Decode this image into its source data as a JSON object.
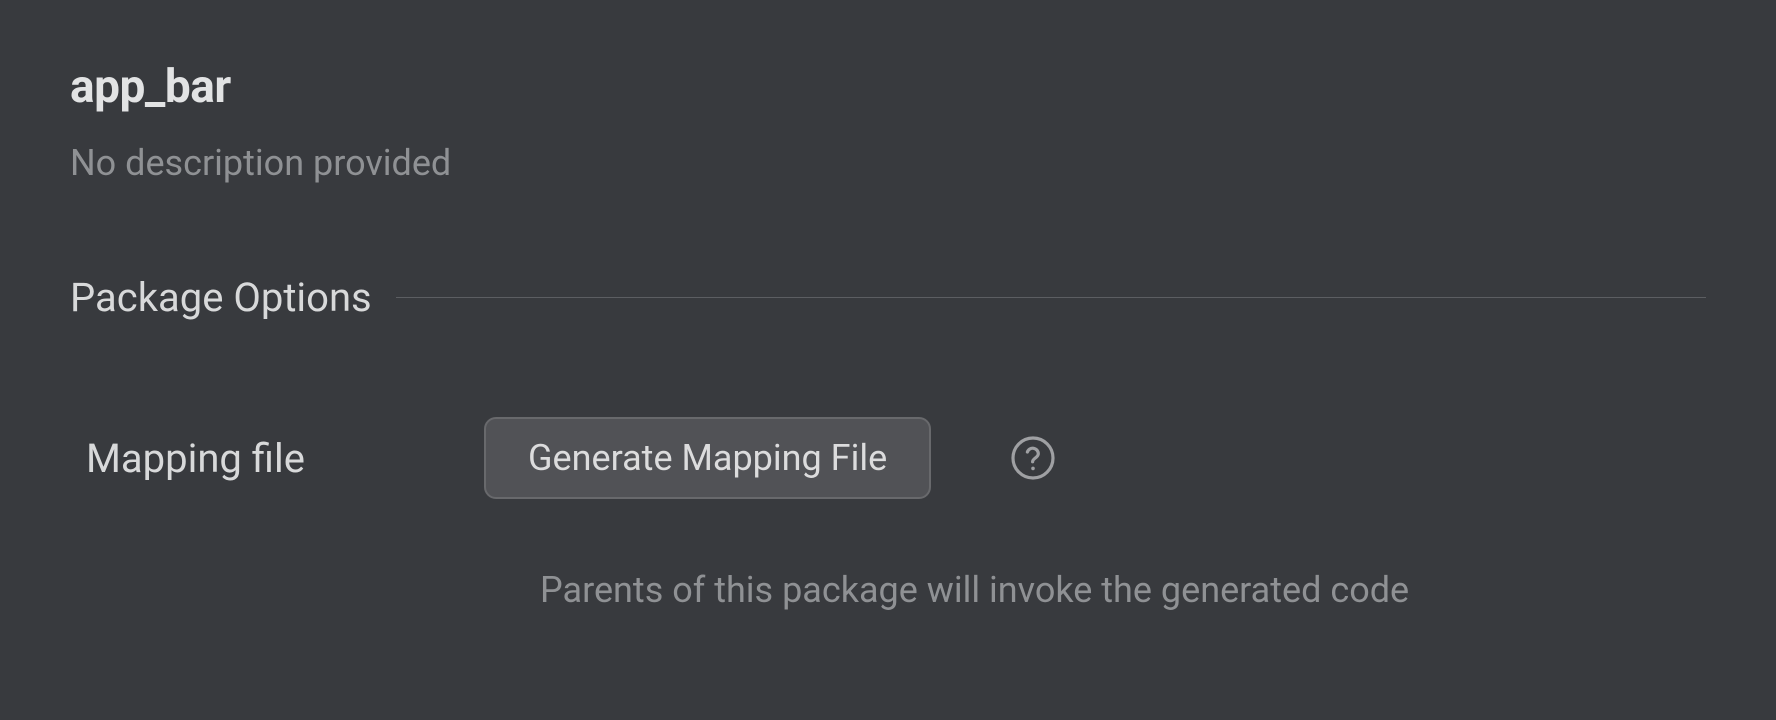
{
  "package": {
    "name": "app_bar",
    "description": "No description provided"
  },
  "section": {
    "title": "Package Options"
  },
  "options": {
    "mapping_file": {
      "label": "Mapping file",
      "button_label": "Generate Mapping File",
      "hint": "Parents of this package will invoke the generated code"
    }
  }
}
